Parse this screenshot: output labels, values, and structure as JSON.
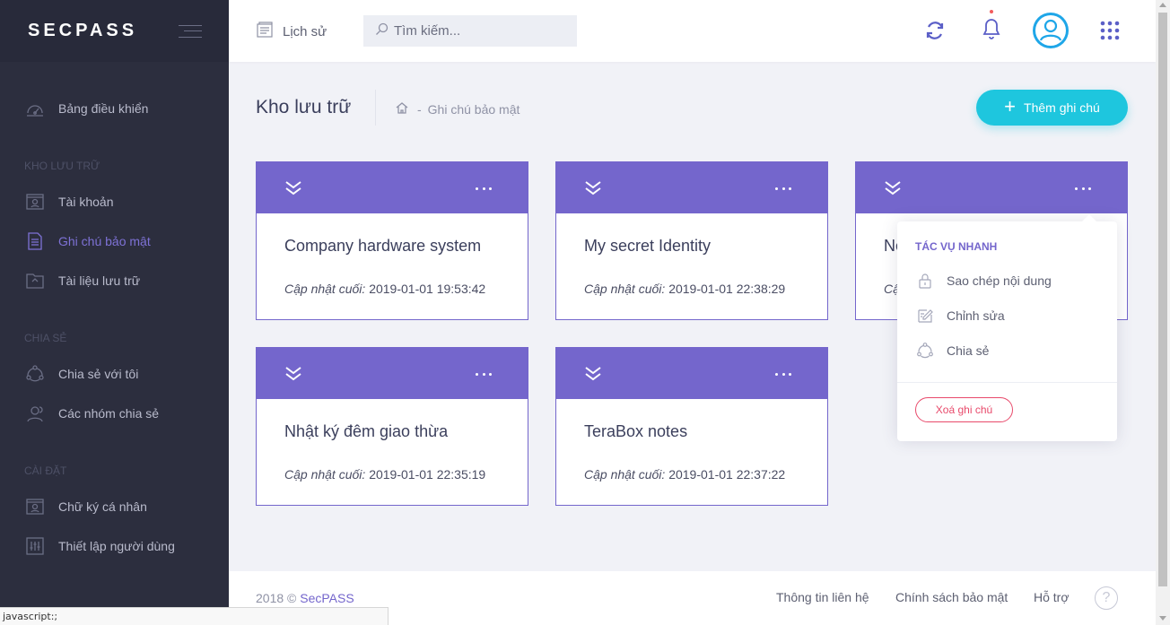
{
  "brand": "SECPASS",
  "sidebar": {
    "items": [
      {
        "label": "Bảng điều khiển",
        "icon": "dashboard-icon"
      },
      {
        "label": "Tài khoản",
        "icon": "account-icon"
      },
      {
        "label": "Ghi chú bảo mật",
        "icon": "note-icon",
        "active": true
      },
      {
        "label": "Tài liệu lưu trữ",
        "icon": "folder-icon"
      },
      {
        "label": "Chia sẻ với tôi",
        "icon": "share-icon"
      },
      {
        "label": "Các nhóm chia sẻ",
        "icon": "group-icon"
      },
      {
        "label": "Chữ ký cá nhân",
        "icon": "signature-icon"
      },
      {
        "label": "Thiết lập người dùng",
        "icon": "settings-icon"
      }
    ],
    "sections": [
      "Kho lưu trữ",
      "Chia sẻ",
      "Cài đặt"
    ]
  },
  "header": {
    "history_label": "Lịch sử",
    "search_placeholder": "Tìm kiếm..."
  },
  "subheader": {
    "title": "Kho lưu trữ",
    "breadcrumb": "Ghi chú bảo mật",
    "add_button": "Thêm ghi chú"
  },
  "cards": [
    {
      "title": "Company hardware system",
      "date_label": "Cập nhật cuối:",
      "date": "2019-01-01 19:53:42"
    },
    {
      "title": "My secret Identity",
      "date_label": "Cập nhật cuối:",
      "date": "2019-01-01 22:38:29"
    },
    {
      "title": "Ne",
      "date_label": "Cậ",
      "date": ""
    },
    {
      "title": "Nhật ký đêm giao thừa",
      "date_label": "Cập nhật cuối:",
      "date": "2019-01-01 22:35:19"
    },
    {
      "title": "TeraBox notes",
      "date_label": "Cập nhật cuối:",
      "date": "2019-01-01 22:37:22"
    }
  ],
  "dropdown": {
    "heading": "TÁC VỤ NHANH",
    "items": [
      {
        "label": "Sao chép nội dung",
        "icon": "lock-icon"
      },
      {
        "label": "Chỉnh sửa",
        "icon": "edit-icon"
      },
      {
        "label": "Chia sẻ",
        "icon": "share-icon"
      }
    ],
    "delete_label": "Xoá ghi chú"
  },
  "footer": {
    "year": "2018 ©",
    "brand_link": "SecPASS",
    "links": [
      "Thông tin liên hệ",
      "Chính sách bảo mật",
      "Hỗ trợ"
    ],
    "help": "?"
  },
  "statusbar": "javascript:;",
  "colors": {
    "primary": "#7466cc",
    "accent": "#1ec6de",
    "sidebar": "#2c2e3e",
    "danger": "#e84a6b"
  }
}
